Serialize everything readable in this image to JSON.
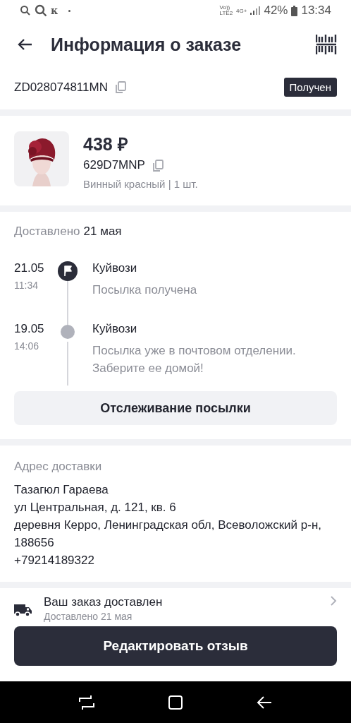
{
  "status_bar": {
    "notification_letter": "к",
    "volte": "Vo))",
    "lte": "LTE2",
    "network": "4G+",
    "battery": "42%",
    "time": "13:34"
  },
  "header": {
    "title": "Информация о заказе"
  },
  "order": {
    "number": "ZD028074811MN",
    "status": "Получен"
  },
  "product": {
    "price": "438 ₽",
    "sku": "629D7MNP",
    "variant": "Винный красный | 1 шт."
  },
  "delivery": {
    "label": "Доставлено",
    "date": "21 мая",
    "events": [
      {
        "kind": "flag",
        "date": "21.05",
        "time": "11:34",
        "carrier": "Куйвози",
        "description": "Посылка получена"
      },
      {
        "kind": "dot",
        "date": "19.05",
        "time": "14:06",
        "carrier": "Куйвози",
        "description": "Посылка уже в почтовом отделении. Заберите ее домой!"
      }
    ],
    "track_button": "Отслеживание посылки"
  },
  "address": {
    "heading": "Адрес доставки",
    "name": "Тазагюл Гараева",
    "lines": [
      "ул Центральная, д. 121, кв. 6",
      "деревня Керро, Ленинградская обл, Всеволожский р-н, 188656"
    ],
    "phone": "+79214189322"
  },
  "shipping_row": {
    "title": "Ваш заказ доставлен",
    "subtitle": "Доставлено 21 мая"
  },
  "review_button": "Редактировать отзыв"
}
